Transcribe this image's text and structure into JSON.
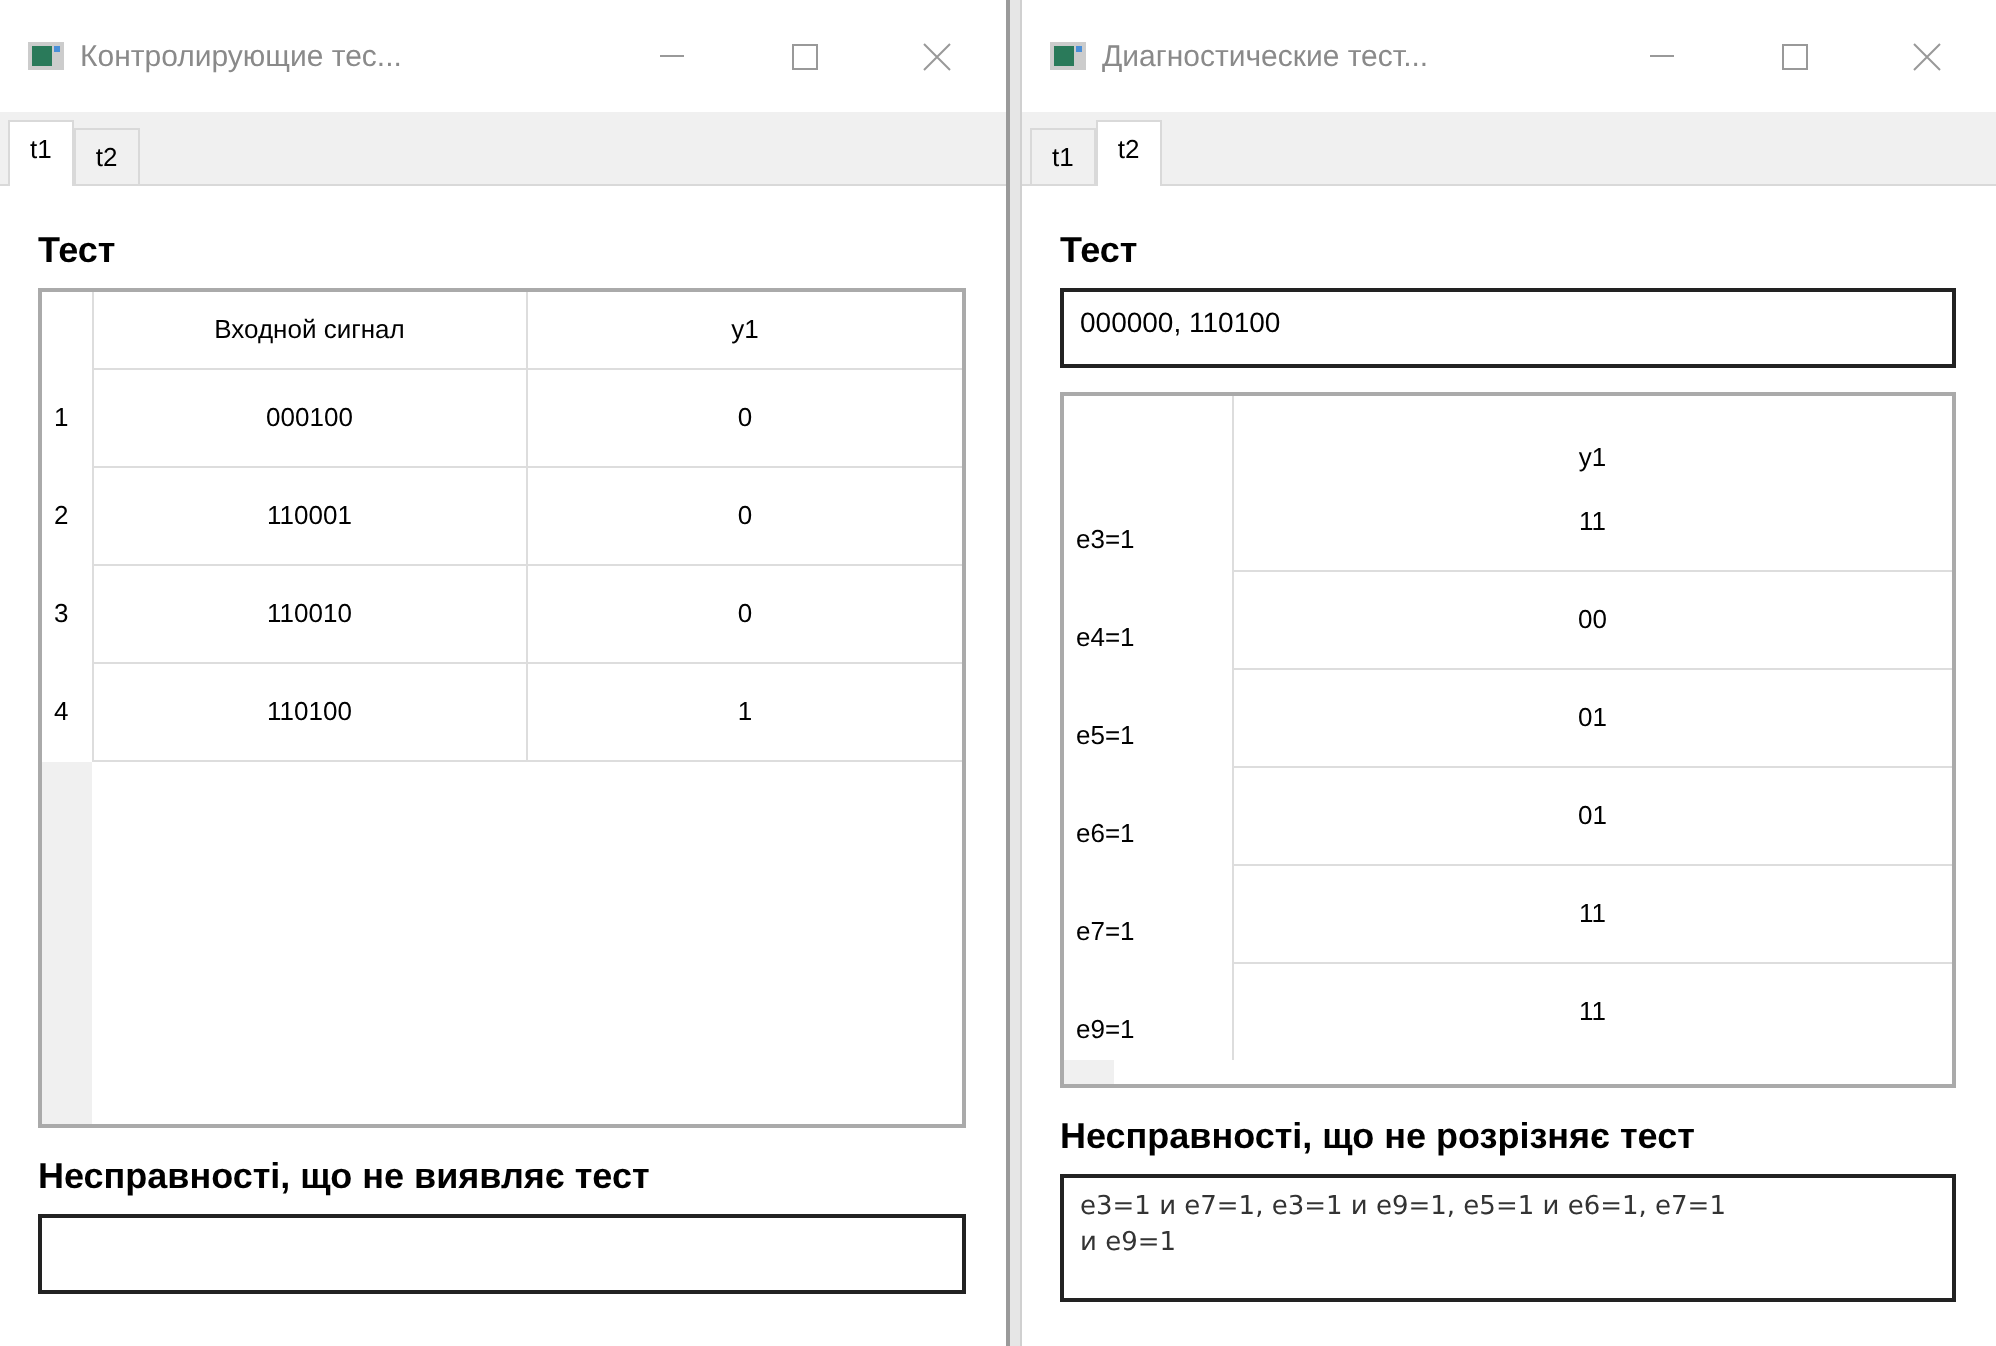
{
  "windows": [
    {
      "title": "Контролирующие тес...",
      "tabs": [
        {
          "label": "t1",
          "selected": true
        },
        {
          "label": "t2",
          "selected": false
        }
      ],
      "sections": [
        {
          "kind": "table",
          "heading": "Тест",
          "columns": [
            "Входной сигнал",
            "y1"
          ],
          "rows": [
            {
              "header": "1",
              "cells": [
                "000100",
                "0"
              ]
            },
            {
              "header": "2",
              "cells": [
                "110001",
                "0"
              ]
            },
            {
              "header": "3",
              "cells": [
                "110010",
                "0"
              ]
            },
            {
              "header": "4",
              "cells": [
                "110100",
                "1"
              ]
            }
          ]
        },
        {
          "kind": "field",
          "heading": "Несправності, що не виявляє тест"
        }
      ]
    },
    {
      "title": "Диагностические тест...",
      "tabs": [
        {
          "label": "t1",
          "selected": false
        },
        {
          "label": "t2",
          "selected": true
        }
      ],
      "sections": [
        {
          "kind": "field",
          "heading": "Тест",
          "value": "000000, 110100"
        },
        {
          "kind": "table",
          "columns": [
            "y1"
          ],
          "rows": [
            {
              "header": "e3=1",
              "cells": [
                "11"
              ]
            },
            {
              "header": "e4=1",
              "cells": [
                "00"
              ]
            },
            {
              "header": "e5=1",
              "cells": [
                "01"
              ]
            },
            {
              "header": "e6=1",
              "cells": [
                "01"
              ]
            },
            {
              "header": "e7=1",
              "cells": [
                "11"
              ]
            },
            {
              "header": "e9=1",
              "cells": [
                "11"
              ]
            }
          ]
        },
        {
          "kind": "field",
          "heading": "Несправності, що не розрізняє тест",
          "value": "e3=1 и e7=1, e3=1 и e9=1, e5=1 и e6=1, e7=1 и e9=1"
        }
      ]
    }
  ]
}
